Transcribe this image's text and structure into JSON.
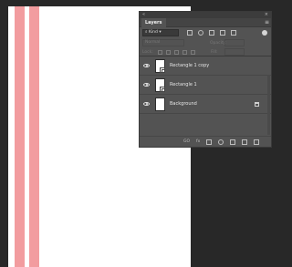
{
  "document": {
    "background": "#ffffff",
    "stripe_color": "#f29c9f"
  },
  "panel": {
    "collapse_glyph": "«",
    "close_glyph": "×",
    "tab_label": "Layers",
    "menu_glyph": "≡",
    "filter": {
      "kind_label": "⌕ Kind",
      "chevron": "▾"
    },
    "blend_mode": "Normal",
    "opacity_label": "Opacity:",
    "lock_label": "Lock:",
    "fill_label": "Fill:",
    "layers": [
      {
        "name": "Rectangle 1 copy",
        "visible": true,
        "smart_object": true
      },
      {
        "name": "Rectangle 1",
        "visible": true,
        "smart_object": true
      },
      {
        "name": "Background",
        "visible": true,
        "locked": true
      }
    ],
    "footer": {
      "link_glyph": "GO",
      "fx_label": "fx"
    }
  }
}
